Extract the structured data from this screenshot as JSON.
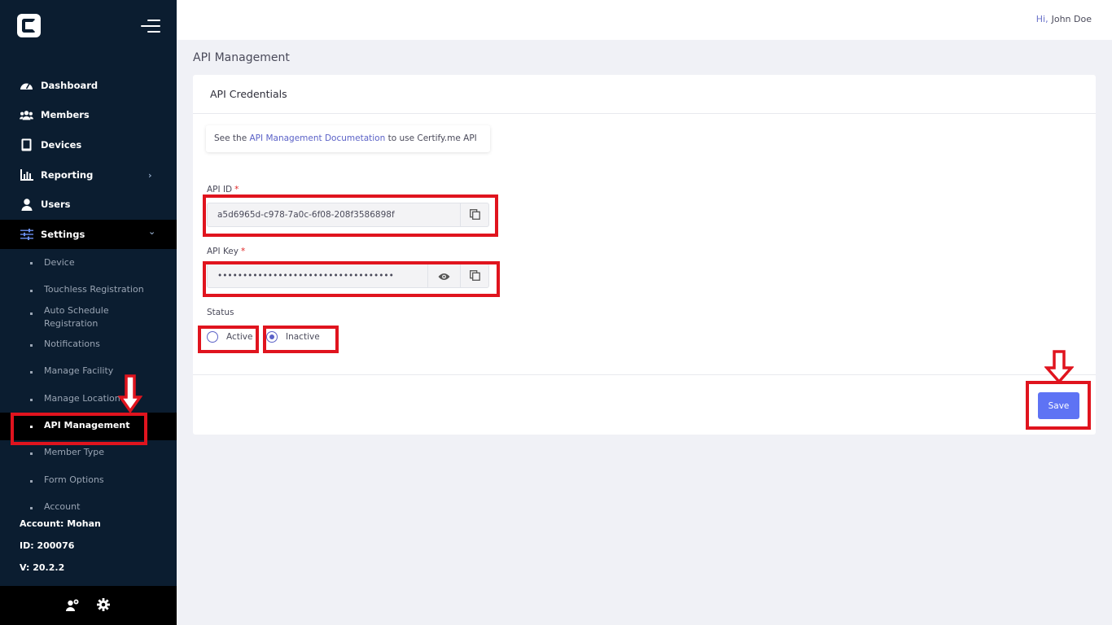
{
  "sidebar": {
    "nav": [
      {
        "label": "Dashboard",
        "icon": "dashboard-icon"
      },
      {
        "label": "Members",
        "icon": "members-icon"
      },
      {
        "label": "Devices",
        "icon": "devices-icon"
      },
      {
        "label": "Reporting",
        "icon": "reporting-icon",
        "chevron": "›"
      },
      {
        "label": "Users",
        "icon": "user-icon"
      },
      {
        "label": "Settings",
        "icon": "settings-sliders-icon",
        "chevron": "⌄"
      }
    ],
    "settings_items": [
      {
        "label": "Device"
      },
      {
        "label": "Touchless Registration"
      },
      {
        "label": "Auto Schedule Registration"
      },
      {
        "label": "Notifications"
      },
      {
        "label": "Manage Facility"
      },
      {
        "label": "Manage Location"
      },
      {
        "label": "API Management"
      },
      {
        "label": "Member Type"
      },
      {
        "label": "Form Options"
      },
      {
        "label": "Account"
      }
    ],
    "account": "Account: Mohan",
    "id": "ID: 200076",
    "version": "V: 20.2.2"
  },
  "header": {
    "greeting": "Hi,",
    "user_name": "John Doe"
  },
  "page": {
    "title": "API Management"
  },
  "card": {
    "title": "API Credentials",
    "note_prefix": "See the",
    "note_link": "API Management Documetation",
    "note_suffix": "to use Certify.me API",
    "api_id_label": "API ID",
    "api_id_value": "a5d6965d-c978-7a0c-6f08-208f3586898f",
    "api_key_label": "API Key",
    "api_key_value": "•••••••••••••••••••••••••••••••••••",
    "required_mark": "*",
    "status_label": "Status",
    "status_options": [
      "Active",
      "Inactive"
    ],
    "status_selected": "Inactive",
    "save_label": "Save"
  },
  "colors": {
    "sidebar_bg": "#0b1d30",
    "accent": "#5e73f4",
    "link": "#5b62c7",
    "annotation": "#e0141e"
  }
}
